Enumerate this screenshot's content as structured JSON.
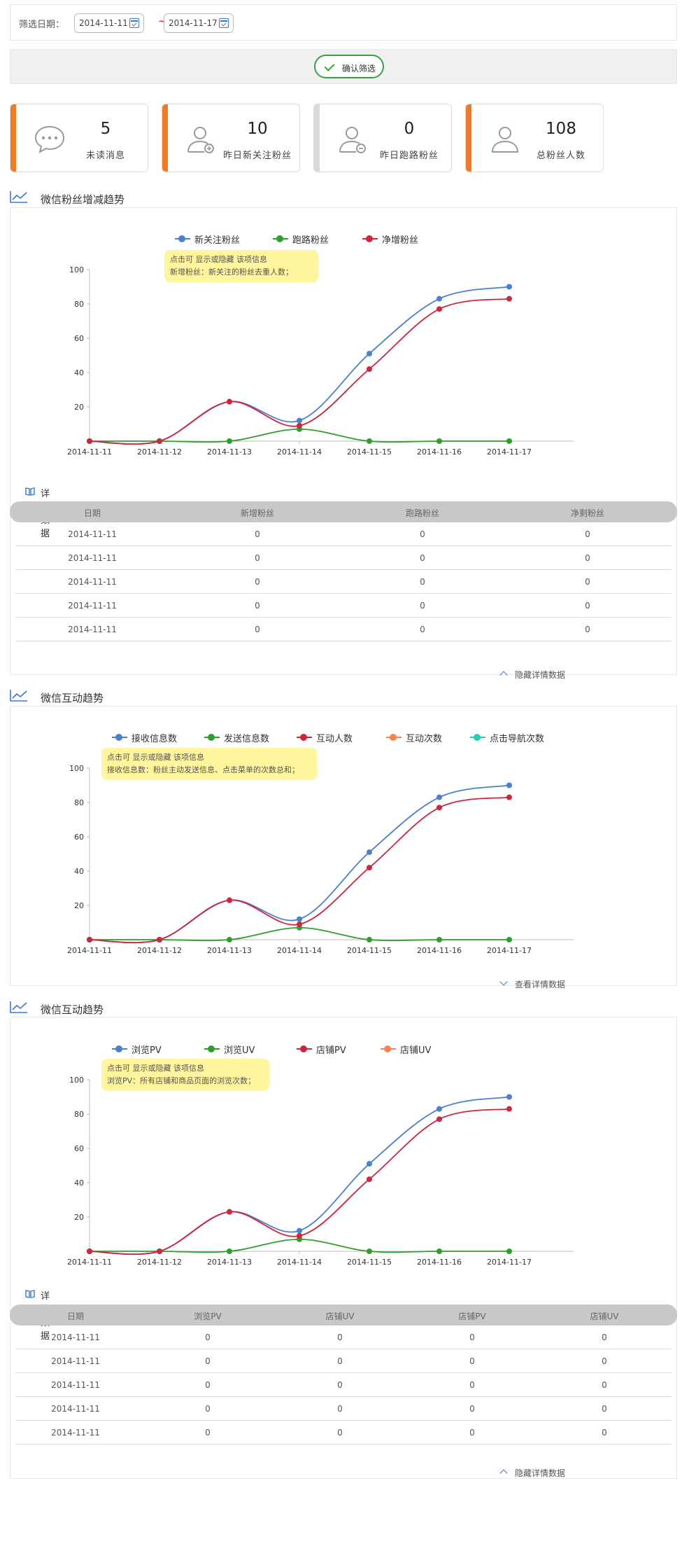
{
  "filter": {
    "label": "筛选日期：",
    "start_date": "2014-11-11",
    "end_date": "2014-11-17",
    "separator": "~",
    "confirm_label": "确认筛选"
  },
  "stats": [
    {
      "value": "5",
      "label": "未读消息",
      "accent": "#f47920",
      "icon": "chat-bubble-icon"
    },
    {
      "value": "10",
      "label": "昨日新关注粉丝",
      "accent": "#f47920",
      "icon": "user-add-icon"
    },
    {
      "value": "0",
      "label": "昨日跑路粉丝",
      "accent": "#d9d9d9",
      "icon": "user-remove-icon"
    },
    {
      "value": "108",
      "label": "总粉丝人数",
      "accent": "#f47920",
      "icon": "user-icon"
    }
  ],
  "sections": [
    {
      "title": "微信粉丝增减趋势",
      "legend": [
        "新关注粉丝",
        "跑路粉丝",
        "净增粉丝"
      ],
      "tooltip": [
        "点击可 显示或隐藏 该项信息",
        "新增粉丝：新关注的粉丝去重人数；"
      ],
      "detail_title": "详情数据",
      "table_headers": [
        "日期",
        "新增粉丝",
        "跑路粉丝",
        "净剩粉丝"
      ],
      "table_rows": [
        [
          "2014-11-11",
          "0",
          "0",
          "0"
        ],
        [
          "2014-11-11",
          "0",
          "0",
          "0"
        ],
        [
          "2014-11-11",
          "0",
          "0",
          "0"
        ],
        [
          "2014-11-11",
          "0",
          "0",
          "0"
        ],
        [
          "2014-11-11",
          "0",
          "0",
          "0"
        ]
      ],
      "toggle_label": "隐藏详情数据"
    },
    {
      "title": "微信互动趋势",
      "legend": [
        "接收信息数",
        "发送信息数",
        "互动人数",
        "互动次数",
        "点击导航次数"
      ],
      "tooltip": [
        "点击可 显示或隐藏 该项信息",
        "接收信息数：粉丝主动发送信息、点击菜单的次数总和；"
      ],
      "toggle_label": "查看详情数据"
    },
    {
      "title": "微信互动趋势",
      "legend": [
        "浏览PV",
        "浏览UV",
        "店铺PV",
        "店铺UV"
      ],
      "tooltip": [
        "点击可 显示或隐藏 该项信息",
        "浏览PV：所有店铺和商品页面的浏览次数；"
      ],
      "detail_title": "详情数据",
      "table_headers": [
        "日期",
        "浏览PV",
        "店铺UV",
        "店铺PV",
        "店铺UV"
      ],
      "table_rows": [
        [
          "2014-11-11",
          "0",
          "0",
          "0",
          "0"
        ],
        [
          "2014-11-11",
          "0",
          "0",
          "0",
          "0"
        ],
        [
          "2014-11-11",
          "0",
          "0",
          "0",
          "0"
        ],
        [
          "2014-11-11",
          "0",
          "0",
          "0",
          "0"
        ],
        [
          "2014-11-11",
          "0",
          "0",
          "0",
          "0"
        ]
      ],
      "toggle_label": "隐藏详情数据"
    }
  ],
  "colors": {
    "blue": "#4a7fd4",
    "green": "#2ca02c",
    "red": "#d0253d",
    "orange": "#ff7f50",
    "teal": "#1fd1b0"
  },
  "chart_data": [
    {
      "type": "line",
      "x": [
        "2014-11-11",
        "2014-11-12",
        "2014-11-13",
        "2014-11-14",
        "2014-11-15",
        "2014-11-16",
        "2014-11-17"
      ],
      "ylim": [
        0,
        100
      ],
      "yticks": [
        20,
        40,
        60,
        80,
        100
      ],
      "series": [
        {
          "name": "新关注粉丝",
          "color": "#4a7fd4",
          "values": [
            0,
            0,
            23,
            12,
            51,
            83,
            90
          ]
        },
        {
          "name": "跑路粉丝",
          "color": "#2ca02c",
          "values": [
            0,
            0,
            0,
            7,
            0,
            0,
            0
          ]
        },
        {
          "name": "净增粉丝",
          "color": "#d0253d",
          "values": [
            0,
            0,
            23,
            9,
            42,
            77,
            83
          ]
        }
      ]
    },
    {
      "type": "line",
      "x": [
        "2014-11-11",
        "2014-11-12",
        "2014-11-13",
        "2014-11-14",
        "2014-11-15",
        "2014-11-16",
        "2014-11-17"
      ],
      "ylim": [
        0,
        100
      ],
      "yticks": [
        20,
        40,
        60,
        80,
        100
      ],
      "series": [
        {
          "name": "接收信息数",
          "color": "#4a7fd4",
          "values": [
            0,
            0,
            23,
            12,
            51,
            83,
            90
          ]
        },
        {
          "name": "发送信息数",
          "color": "#2ca02c",
          "values": [
            0,
            0,
            0,
            7,
            0,
            0,
            0
          ]
        },
        {
          "name": "互动人数",
          "color": "#d0253d",
          "values": [
            0,
            0,
            23,
            9,
            42,
            77,
            83
          ]
        }
      ]
    },
    {
      "type": "line",
      "x": [
        "2014-11-11",
        "2014-11-12",
        "2014-11-13",
        "2014-11-14",
        "2014-11-15",
        "2014-11-16",
        "2014-11-17"
      ],
      "ylim": [
        0,
        100
      ],
      "yticks": [
        20,
        40,
        60,
        80,
        100
      ],
      "series": [
        {
          "name": "浏览PV",
          "color": "#4a7fd4",
          "values": [
            0,
            0,
            23,
            12,
            51,
            83,
            90
          ]
        },
        {
          "name": "浏览UV",
          "color": "#2ca02c",
          "values": [
            0,
            0,
            0,
            7,
            0,
            0,
            0
          ]
        },
        {
          "name": "店铺PV",
          "color": "#d0253d",
          "values": [
            0,
            0,
            23,
            9,
            42,
            77,
            83
          ]
        }
      ]
    }
  ]
}
